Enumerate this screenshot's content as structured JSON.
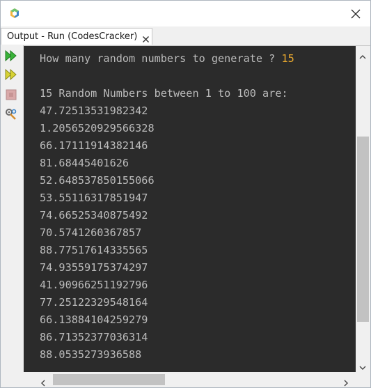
{
  "tab": {
    "label": "Output - Run (CodesCracker)"
  },
  "console": {
    "prompt": "How many random numbers to generate ? ",
    "input_value": "15",
    "header": "15 Random Numbers between 1 to 100 are:",
    "numbers": [
      "47.72513531982342",
      "1.2056520929566328",
      "66.17111914382146",
      "81.68445401626",
      "52.648537850155066",
      "53.55116317851947",
      "74.66525340875492",
      "70.5741260367857",
      "88.77517614335565",
      "74.93559175374297",
      "41.90966251192796",
      "77.25122329548164",
      "66.13884104259279",
      "86.71352377036314",
      "88.0535273936588"
    ]
  },
  "icons": {
    "app": "netbeans-logo-icon",
    "close": "close-icon",
    "tab_close": "close-icon",
    "rerun": "rerun-icon",
    "rerun_with_params": "rerun-with-params-icon",
    "stop": "stop-icon",
    "settings": "settings-icon"
  },
  "colors": {
    "console_bg": "#2b2b2b",
    "console_text": "#bbbbbb",
    "input_text": "#e8a82e",
    "run_green": "#2f9e2f"
  }
}
